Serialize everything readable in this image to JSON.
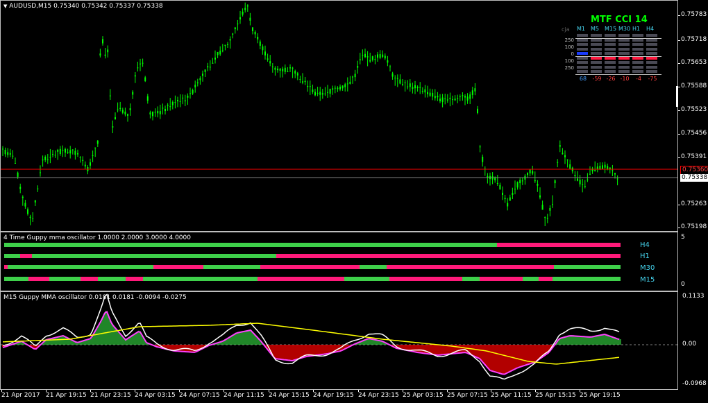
{
  "main": {
    "symbol_arrow": "▼",
    "title": "AUDUSD,M15  0.75340 0.75342 0.75337 0.75338",
    "price_ticks": [
      "0.75783",
      "0.75718",
      "0.75653",
      "0.75588",
      "0.75523",
      "0.75456",
      "0.75391",
      "0.75263",
      "0.75198"
    ],
    "red_line_price": "0.75360",
    "current_price": "0.75338",
    "colors": {
      "bull": "#00ff00",
      "grid": "#bfbfbf",
      "red_line": "#ff0000",
      "current_line": "#808080"
    }
  },
  "mtf_cci": {
    "title": "MTF CCI  14",
    "corner_label": "cja",
    "timeframes": [
      "M1",
      "M5",
      "M15",
      "M30",
      "H1",
      "H4"
    ],
    "levels": [
      "250",
      "100",
      "0",
      "100",
      "250"
    ],
    "values": [
      "68",
      "-59",
      "-26",
      "-10",
      "-4",
      "-75"
    ],
    "value_colors": [
      "#46a0ff",
      "#ff4040",
      "#ff4040",
      "#ff4040",
      "#ff4040",
      "#ff4040"
    ]
  },
  "guppy4": {
    "title": "4 Time Guppy mma oscillator 1.0000 2.0000 3.0000 4.0000",
    "labels": [
      "H4",
      "H1",
      "M30",
      "M15"
    ],
    "scale_top": "5",
    "scale_bottom": "0"
  },
  "m15": {
    "title": "M15 Guppy MMA oscillator 0.0181 0.0181 -0.0094 -0.0275",
    "scale_ticks": [
      "0.1133",
      "0.00",
      "-0.0968"
    ]
  },
  "time_axis": [
    "21 Apr 2017",
    "21 Apr 19:15",
    "21 Apr 23:15",
    "24 Apr 03:15",
    "24 Apr 07:15",
    "24 Apr 11:15",
    "24 Apr 15:15",
    "24 Apr 19:15",
    "24 Apr 23:15",
    "25 Apr 03:15",
    "25 Apr 07:15",
    "25 Apr 11:15",
    "25 Apr 15:15",
    "25 Apr 19:15"
  ]
}
